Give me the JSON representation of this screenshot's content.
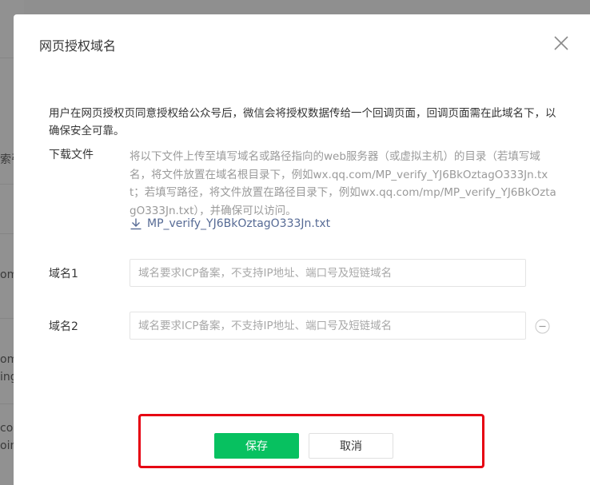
{
  "background": {
    "left_fragments": [
      "索引",
      "om",
      "om",
      "ing",
      "co",
      "oin"
    ]
  },
  "dialog": {
    "title": "网页授权域名",
    "close_icon": "close-icon",
    "description": "用户在网页授权页同意授权给公众号后，微信会将授权数据传给一个回调页面，回调页面需在此域名下，以确保安全可靠。",
    "download": {
      "label": "下载文件",
      "instructions": "将以下文件上传至填写域名或路径指向的web服务器（或虚拟主机）的目录（若填写域名，将文件放置在域名根目录下，例如wx.qq.com/MP_verify_YJ6BkOztagO333Jn.txt；若填写路径，将文件放置在路径目录下，例如wx.qq.com/mp/MP_verify_YJ6BkOztagO333Jn.txt），并确保可以访问。",
      "file_name": "MP_verify_YJ6BkOztagO333Jn.txt",
      "icon": "download-icon"
    },
    "domains": [
      {
        "label": "域名1",
        "value": "",
        "placeholder": "域名要求ICP备案，不支持IP地址、端口号及短链域名"
      },
      {
        "label": "域名2",
        "value": "",
        "placeholder": "域名要求ICP备案，不支持IP地址、端口号及短链域名"
      }
    ],
    "buttons": {
      "save": "保存",
      "cancel": "取消"
    }
  },
  "colors": {
    "primary": "#07c160",
    "link": "#576b95",
    "highlight": "#e60012",
    "overlay": "#8f8f8f"
  }
}
